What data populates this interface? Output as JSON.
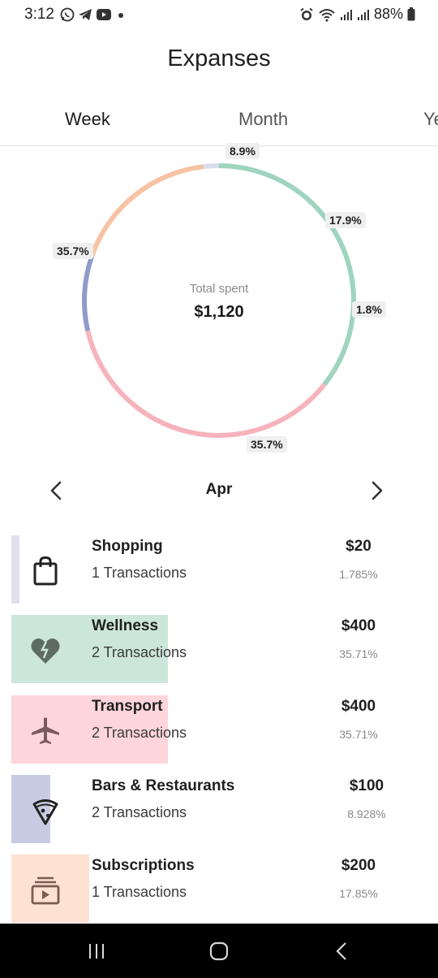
{
  "status_bar": {
    "time": "3:12",
    "battery": "88%",
    "left_icons": [
      "whatsapp-icon",
      "telegram-icon",
      "youtube-icon",
      "dot-icon"
    ],
    "right_icons": [
      "alarm-icon",
      "wifi-icon",
      "signal-icon",
      "signal-icon",
      "battery-icon"
    ]
  },
  "header": {
    "title": "Expanses"
  },
  "tabs": [
    {
      "label": "Week",
      "selected": true
    },
    {
      "label": "Month",
      "selected": false
    },
    {
      "label": "Ye",
      "selected": false
    }
  ],
  "summary": {
    "label": "Total spent",
    "value": "$1,120"
  },
  "chart_data": {
    "type": "pie",
    "total": 1120,
    "slices": [
      {
        "name": "Bars & Restaurants",
        "value": 100,
        "percent_label": "8.9%",
        "color": "#8f9cc9"
      },
      {
        "name": "Subscriptions",
        "value": 200,
        "percent_label": "17.9%",
        "color": "#f7c3a4"
      },
      {
        "name": "Shopping",
        "value": 20,
        "percent_label": "1.8%",
        "color": "#dcdcef"
      },
      {
        "name": "Wellness",
        "value": 400,
        "percent_label": "35.7%",
        "color": "#9fd4bf"
      },
      {
        "name": "Transport",
        "value": 400,
        "percent_label": "35.7%",
        "color": "#f6b3bb"
      }
    ]
  },
  "month_nav": {
    "label": "Apr",
    "prev_icon": "chevron-left-icon",
    "next_icon": "chevron-right-icon"
  },
  "categories": [
    {
      "name": "Shopping",
      "transactions": "1 Transactions",
      "amount": "$20",
      "percent": "1.785%",
      "icon": "shopping-bag-icon",
      "color": "#e0e0ee",
      "fill": 0.0178
    },
    {
      "name": "Wellness",
      "transactions": "2 Transactions",
      "amount": "$400",
      "percent": "35.71%",
      "icon": "broken-heart-icon",
      "color": "#cde6dc",
      "fill": 0.3571
    },
    {
      "name": "Transport",
      "transactions": "2 Transactions",
      "amount": "$400",
      "percent": "35.71%",
      "icon": "airplane-icon",
      "color": "#fdd5da",
      "fill": 0.3571
    },
    {
      "name": "Bars & Restaurants",
      "transactions": "2 Transactions",
      "amount": "$100",
      "percent": "8.928%",
      "icon": "pizza-icon",
      "color": "#c8cce3",
      "fill": 0.0893
    },
    {
      "name": "Subscriptions",
      "transactions": "1 Transactions",
      "amount": "$200",
      "percent": "17.85%",
      "icon": "subscriptions-icon",
      "color": "#fde1d3",
      "fill": 0.1785
    }
  ],
  "system_nav": {
    "recent": "recent-apps-icon",
    "home": "home-icon",
    "back": "back-icon"
  }
}
